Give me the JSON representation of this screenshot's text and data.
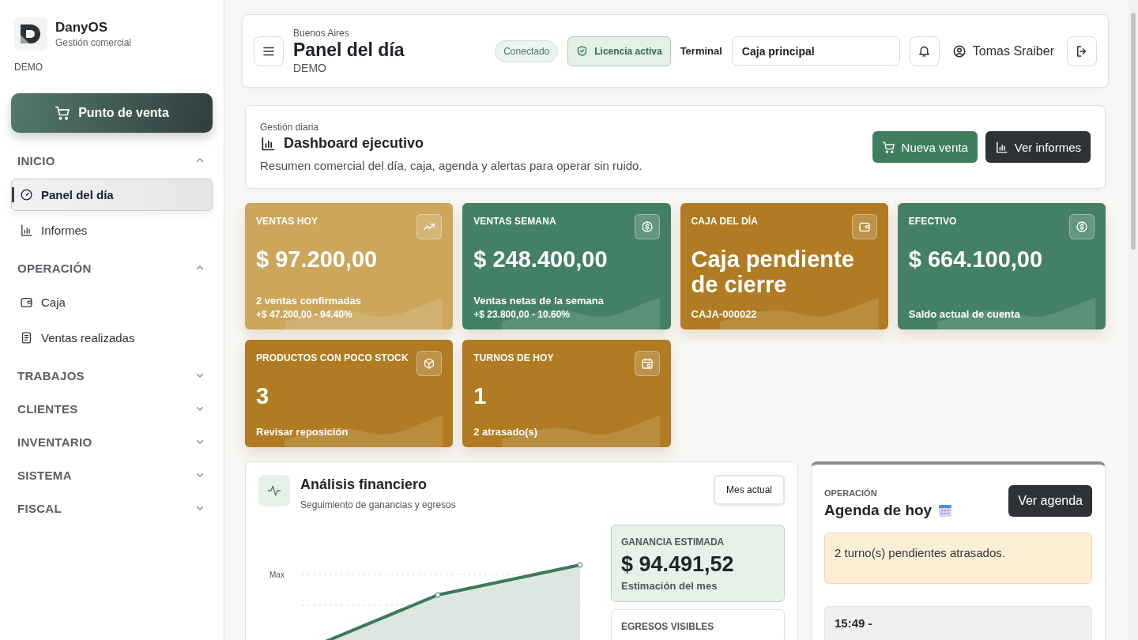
{
  "brand": {
    "name": "DanyOS",
    "subtitle": "Gestión comercial",
    "badge": "DEMO"
  },
  "pos_button": {
    "label": "Punto de venta"
  },
  "sidebar": {
    "sections": [
      {
        "label": "INICIO",
        "expanded": true,
        "items": [
          {
            "label": "Panel del día",
            "kind": "gauge",
            "selected": true
          },
          {
            "label": "Informes",
            "kind": "chart",
            "selected": false
          }
        ]
      },
      {
        "label": "OPERACIÓN",
        "expanded": true,
        "items": [
          {
            "label": "Caja",
            "kind": "wallet",
            "selected": false
          },
          {
            "label": "Ventas realizadas",
            "kind": "doc",
            "selected": false
          }
        ]
      },
      {
        "label": "TRABAJOS",
        "expanded": false
      },
      {
        "label": "CLIENTES",
        "expanded": false
      },
      {
        "label": "INVENTARIO",
        "expanded": false
      },
      {
        "label": "SISTEMA",
        "expanded": false
      },
      {
        "label": "FISCAL",
        "expanded": false
      }
    ]
  },
  "header": {
    "location": "Buenos Aires",
    "title": "Panel del día",
    "subtitle": "DEMO",
    "status": "Conectado",
    "license": "Licencia activa",
    "terminal_label": "Terminal",
    "terminal": "Caja principal",
    "user": "Tomas Sraiber"
  },
  "summary": {
    "eyebrow": "Gestión diaria",
    "title": "Dashboard ejecutivo",
    "description": "Resumen comercial del día, caja, agenda y alertas para operar sin ruido.",
    "buttons": [
      {
        "label": "Nueva venta",
        "kind": "primary"
      },
      {
        "label": "Ver informes",
        "kind": "dark"
      }
    ]
  },
  "kpis": [
    {
      "title": "VENTAS HOY",
      "value": "$ 97.200,00",
      "lines": [
        "2 ventas confirmadas",
        "+$ 47.200,00 - 94.40%"
      ],
      "kind": "trend",
      "color": "#cba65b"
    },
    {
      "title": "VENTAS SEMANA",
      "value": "$ 248.400,00",
      "lines": [
        "Ventas netas de la semana",
        "+$ 23.800,00 - 10.60%"
      ],
      "kind": "dollar",
      "color": "#438066"
    },
    {
      "title": "CAJA DEL DÍA",
      "value": "Caja pendiente de cierre",
      "lines": [
        "CAJA-000022"
      ],
      "kind": "wallet",
      "color": "#b07b22"
    },
    {
      "title": "EFECTIVO",
      "value": "$ 664.100,00",
      "lines": [
        "Saldo actual de cuenta"
      ],
      "kind": "dollar",
      "color": "#438066"
    },
    {
      "title": "PRODUCTOS CON POCO STOCK",
      "value": "3",
      "lines": [
        "Revisar reposición"
      ],
      "kind": "box",
      "color": "#b07b22"
    },
    {
      "title": "TURNOS DE HOY",
      "value": "1",
      "lines": [
        "2 atrasado(s)"
      ],
      "kind": "calendar",
      "color": "#b07b22"
    }
  ],
  "finance": {
    "title": "Análisis financiero",
    "subtitle": "Seguimiento de ganancias y egresos",
    "period": "Mes actual",
    "chart_label": "Max",
    "stats": [
      {
        "label": "GANANCIA ESTIMADA",
        "value": "$ 94.491,52",
        "note": "Estimación del mes",
        "highlighted": true
      },
      {
        "label": "EGRESOS VISIBLES",
        "highlighted": false
      }
    ]
  },
  "agenda": {
    "eyebrow": "OPERACIÓN",
    "title": "Agenda de hoy",
    "button": "Ver agenda",
    "alert": "2 turno(s) pendientes atrasados.",
    "items": [
      {
        "time": "15:49 -"
      }
    ]
  }
}
